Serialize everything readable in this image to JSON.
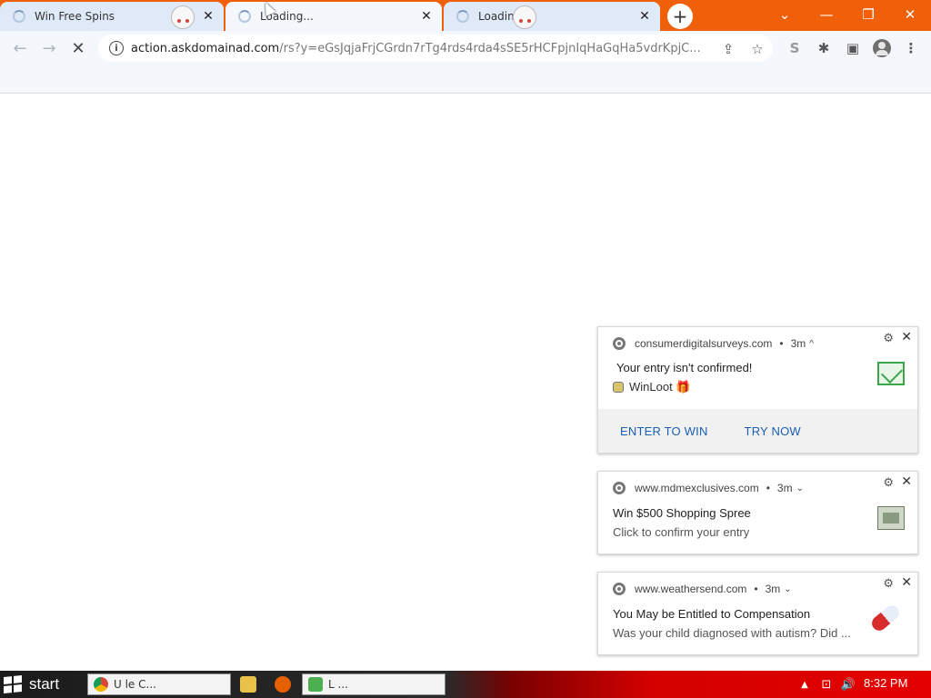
{
  "tabs": [
    {
      "title": "Win Free Spins",
      "close": "✕"
    },
    {
      "title": "Loading...",
      "close": "✕"
    },
    {
      "title": "Loading...",
      "close": "✕"
    }
  ],
  "new_tab": "+",
  "window_controls": {
    "dropdown": "⌄",
    "minimize": "—",
    "restore": "❐",
    "close": "✕"
  },
  "toolbar": {
    "back": "←",
    "forward": "→",
    "stop": "✕",
    "url_host": "action.askdomainad.com",
    "url_path": "/rs?y=eGsJqjaFrjCGrdn7rTg4rds4rda4sSE5rHCFpjnIqHaGqHa5vdrKpjC...",
    "share": "⇪",
    "bookmark_star": "☆",
    "extension_s": "S",
    "extensions": "✱",
    "side_panel": "▣",
    "menu": "⋮"
  },
  "notifications": [
    {
      "site": "consumerdigitalsurveys.com",
      "time": "3m",
      "chevron": "^",
      "title": "Your entry isn't confirmed!",
      "body": "WinLoot 🎁",
      "actions": [
        "ENTER TO WIN",
        "TRY NOW"
      ]
    },
    {
      "site": "www.mdmexclusives.com",
      "time": "3m",
      "chevron": "⌄",
      "title": "Win $500 Shopping Spree",
      "body": "Click to confirm your entry"
    },
    {
      "site": "www.weathersend.com",
      "time": "3m",
      "chevron": "⌄",
      "title": "You May be Entitled to Compensation",
      "body": "Was your child diagnosed with autism? Did ..."
    }
  ],
  "taskbar": {
    "start_label": "start",
    "tasks": [
      "U            le C...",
      "L      ..."
    ],
    "tray_up": "▲",
    "tray_net": "⊡",
    "tray_vol": "🔊",
    "clock": "8:32 PM"
  }
}
